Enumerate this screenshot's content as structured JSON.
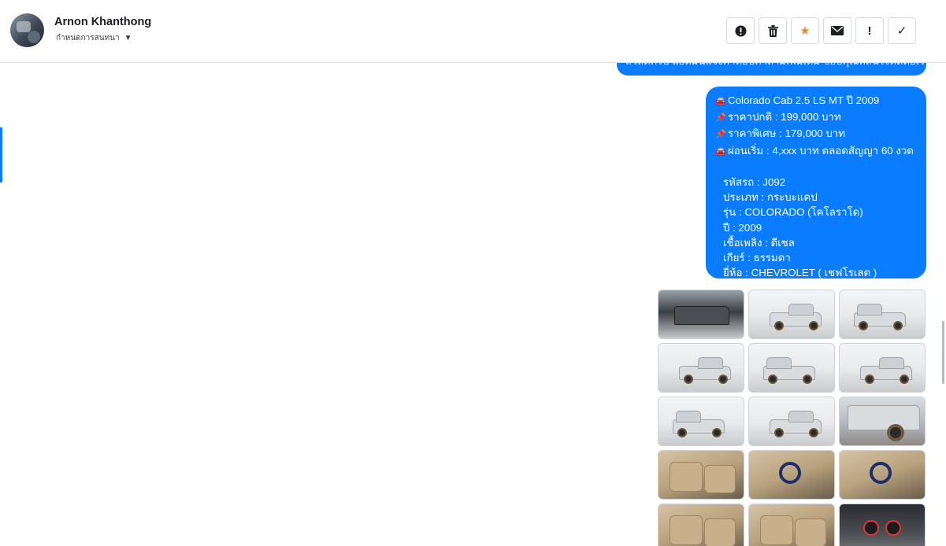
{
  "header": {
    "contact_name": "Arnon Khanthong",
    "status_label": "กำหนดการสนทนา",
    "actions": [
      {
        "name": "report-button",
        "icon": "alert-circle-icon",
        "glyph": "!"
      },
      {
        "name": "delete-button",
        "icon": "trash-icon",
        "glyph": ""
      },
      {
        "name": "star-button",
        "icon": "star-icon",
        "glyph": "★"
      },
      {
        "name": "email-button",
        "icon": "envelope-icon",
        "glyph": "✉"
      },
      {
        "name": "mark-important-button",
        "icon": "exclamation-icon",
        "glyph": "!"
      },
      {
        "name": "mark-done-button",
        "icon": "checkmark-icon",
        "glyph": "✓"
      }
    ]
  },
  "messages": {
    "previous_text": "สวัสดีครับ แอดมินแจ้งคำตอบคำถามเพิ่มเติม ขอบคุณที่สนใจติดต่อเรานะครับ",
    "listing": {
      "title_line": "Colorado Cab 2.5 LS MT ปี 2009",
      "normal_price": "ราคาปกติ : 199,000 บาท",
      "special_price": "ราคาพิเศษ : 179,000 บาท",
      "installment": "ผ่อนเริ่ม : 4,xxx บาท ตลอดสัญญา 60 งวด",
      "car_code": "รหัสรถ : J092",
      "type": "ประเภท : กระบะแคป",
      "model": "รุ่น : COLORADO (โคโลราโด)",
      "year": "ปี : 2009",
      "fuel": "เชื้อเพลิง : ดีเซล",
      "gear": "เกียร์ : ธรรมดา",
      "brand": "ยี่ห้อ : CHEVROLET ( เชฟโรเลต )"
    },
    "emoji": {
      "car": "🚘",
      "pin": "📌"
    }
  },
  "photos": [
    {
      "name": "photo-engine-bay",
      "kind": "engine"
    },
    {
      "name": "photo-front-left",
      "kind": "studio"
    },
    {
      "name": "photo-front",
      "kind": "studio"
    },
    {
      "name": "photo-front-three-quarter",
      "kind": "studio"
    },
    {
      "name": "photo-rear-three-quarter",
      "kind": "studio"
    },
    {
      "name": "photo-rear",
      "kind": "studio"
    },
    {
      "name": "photo-rear-left",
      "kind": "studio"
    },
    {
      "name": "photo-side-profile",
      "kind": "studio"
    },
    {
      "name": "photo-wheel-closeup",
      "kind": "side"
    },
    {
      "name": "photo-door-panel",
      "kind": "interior"
    },
    {
      "name": "photo-steering-wheel",
      "kind": "interior"
    },
    {
      "name": "photo-steering-closeup",
      "kind": "interior"
    },
    {
      "name": "photo-rear-seat",
      "kind": "interior"
    },
    {
      "name": "photo-seat-fabric",
      "kind": "interior"
    },
    {
      "name": "photo-dashboard-gauges",
      "kind": "dash"
    }
  ],
  "colors": {
    "bubble": "#0a7cff",
    "star": "#f0892a"
  }
}
